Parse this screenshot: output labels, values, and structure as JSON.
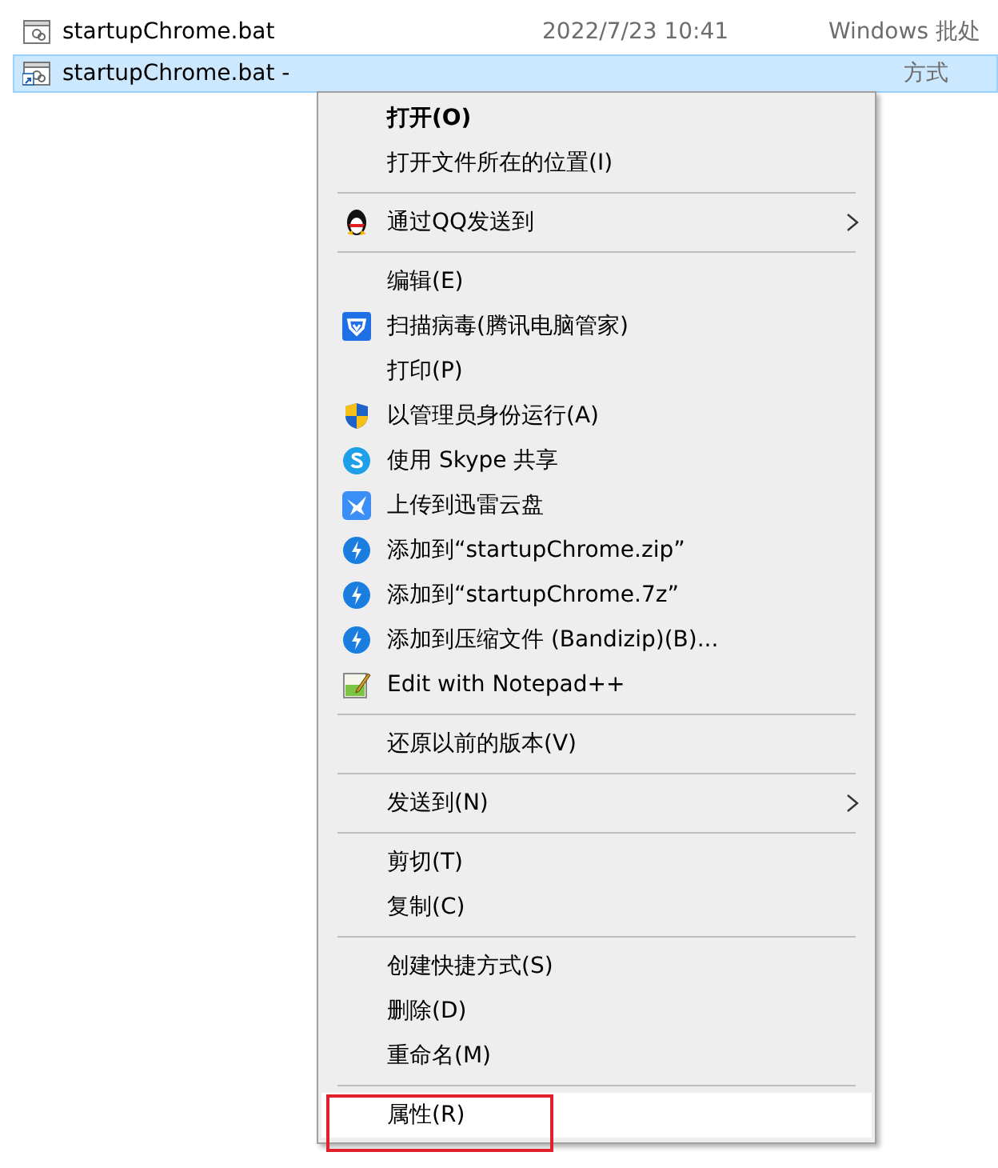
{
  "files": [
    {
      "name": "startupChrome.bat",
      "date": "2022/7/23 10:41",
      "type": "Windows 批处",
      "selected": false
    },
    {
      "name": "startupChrome.bat -",
      "type": "方式",
      "selected": true
    }
  ],
  "menu": [
    {
      "kind": "item",
      "label": "打开(O)",
      "bold": true,
      "submenu": false,
      "selected": false,
      "outlined": false
    },
    {
      "kind": "item",
      "label": "打开文件所在的位置(I)",
      "bold": false,
      "submenu": false,
      "selected": false,
      "outlined": false
    },
    {
      "kind": "separator"
    },
    {
      "kind": "item",
      "label": "通过QQ发送到",
      "bold": false,
      "submenu": true,
      "selected": false,
      "outlined": false
    },
    {
      "kind": "separator"
    },
    {
      "kind": "item",
      "label": "编辑(E)",
      "bold": false,
      "submenu": false,
      "selected": false,
      "outlined": false
    },
    {
      "kind": "item",
      "label": "扫描病毒(腾讯电脑管家)",
      "bold": false,
      "submenu": false,
      "selected": false,
      "outlined": false
    },
    {
      "kind": "item",
      "label": "打印(P)",
      "bold": false,
      "submenu": false,
      "selected": false,
      "outlined": false
    },
    {
      "kind": "item",
      "label": "以管理员身份运行(A)",
      "bold": false,
      "submenu": false,
      "selected": false,
      "outlined": false
    },
    {
      "kind": "item",
      "label": "使用 Skype 共享",
      "bold": false,
      "submenu": false,
      "selected": false,
      "outlined": false
    },
    {
      "kind": "item",
      "label": "上传到迅雷云盘",
      "bold": false,
      "submenu": false,
      "selected": false,
      "outlined": false
    },
    {
      "kind": "item",
      "label": "添加到“startupChrome.zip”",
      "bold": false,
      "submenu": false,
      "selected": false,
      "outlined": false
    },
    {
      "kind": "item",
      "label": "添加到“startupChrome.7z”",
      "bold": false,
      "submenu": false,
      "selected": false,
      "outlined": false
    },
    {
      "kind": "item",
      "label": "添加到压缩文件 (Bandizip)(B)...",
      "bold": false,
      "submenu": false,
      "selected": false,
      "outlined": false
    },
    {
      "kind": "item",
      "label": "Edit with Notepad++",
      "bold": false,
      "submenu": false,
      "selected": false,
      "outlined": false
    },
    {
      "kind": "separator"
    },
    {
      "kind": "item",
      "label": "还原以前的版本(V)",
      "bold": false,
      "submenu": false,
      "selected": false,
      "outlined": false
    },
    {
      "kind": "separator"
    },
    {
      "kind": "item",
      "label": "发送到(N)",
      "bold": false,
      "submenu": true,
      "selected": false,
      "outlined": false
    },
    {
      "kind": "separator"
    },
    {
      "kind": "item",
      "label": "剪切(T)",
      "bold": false,
      "submenu": false,
      "selected": false,
      "outlined": false
    },
    {
      "kind": "item",
      "label": "复制(C)",
      "bold": false,
      "submenu": false,
      "selected": false,
      "outlined": false
    },
    {
      "kind": "separator"
    },
    {
      "kind": "item",
      "label": "创建快捷方式(S)",
      "bold": false,
      "submenu": false,
      "selected": false,
      "outlined": false
    },
    {
      "kind": "item",
      "label": "删除(D)",
      "bold": false,
      "submenu": false,
      "selected": false,
      "outlined": false
    },
    {
      "kind": "item",
      "label": "重命名(M)",
      "bold": false,
      "submenu": false,
      "selected": false,
      "outlined": false
    },
    {
      "kind": "separator"
    },
    {
      "kind": "item",
      "label": "属性(R)",
      "bold": false,
      "submenu": false,
      "selected": true,
      "outlined": true
    }
  ]
}
